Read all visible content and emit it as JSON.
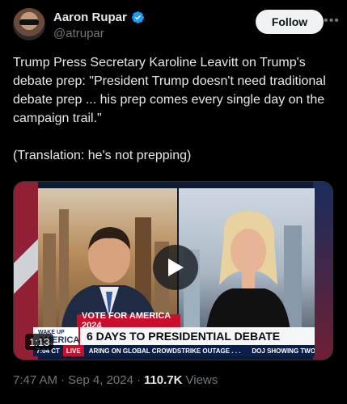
{
  "author": {
    "name": "Aaron Rupar",
    "handle": "@atrupar",
    "verified": true
  },
  "follow_label": "Follow",
  "more_icon": "more-horizontal-icon",
  "tweet": {
    "line1": "Trump Press Secretary Karoline Leavitt on Trump's debate prep: \"President Trump doesn't need traditional debate prep ... his prep comes every single day on the campaign trail.\"",
    "line2": "(Translation: he's not prepping)"
  },
  "video": {
    "duration": "1:13",
    "banner_top": "VOTE FOR AMERICA 2024",
    "headline": "6 DAYS TO PRESIDENTIAL DEBATE",
    "show_name_small": "WAKE UP",
    "show_name_big": "AMERICA",
    "ticker_time": "7:04 CT",
    "ticker_live": "LIVE",
    "ticker_1": "ARING ON GLOBAL CROWDSTRIKE OUTAGE . . .",
    "ticker_2": "DOJ SHOWING TWO STANDARDS ON"
  },
  "meta": {
    "time": "7:47 AM",
    "date": "Sep 4, 2024",
    "views_count": "110.7K",
    "views_label": "Views",
    "separator": "·"
  },
  "colors": {
    "accent_blue": "#1d9bf0",
    "background": "#000000",
    "muted": "#71767b"
  }
}
